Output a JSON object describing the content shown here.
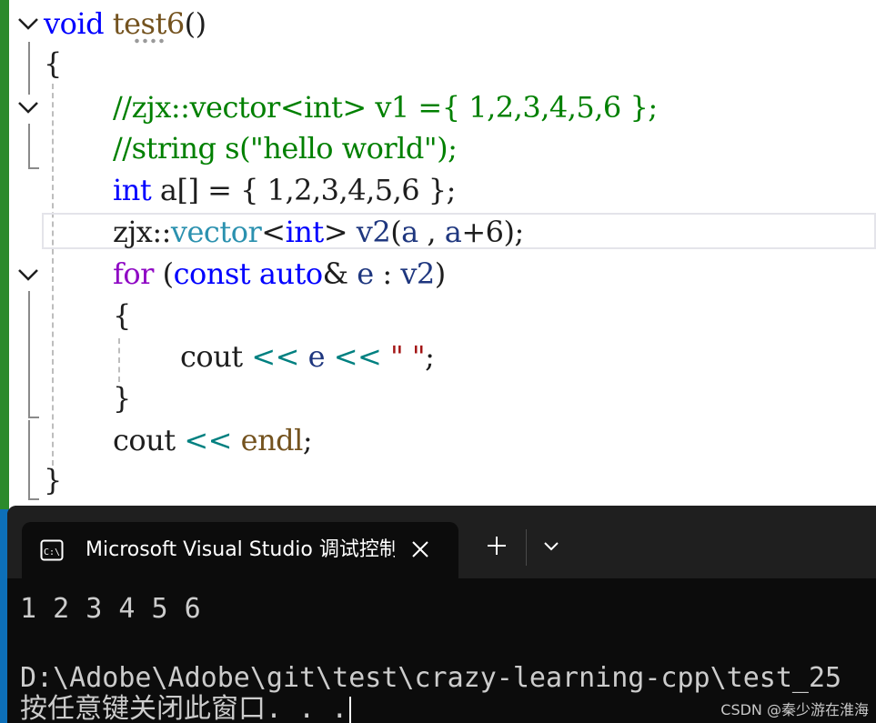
{
  "editor": {
    "lines": {
      "l1": {
        "kw": "void",
        "fn": "test6",
        "rest": "()"
      },
      "l2": {
        "text": "{"
      },
      "l3": {
        "text": "//zjx::vector<int> v1 ={ 1,2,3,4,5,6 };"
      },
      "l4": {
        "text": "//string s(\"hello world\");"
      },
      "l5": {
        "kw": "int",
        "rest": " a[] = { 1,2,3,4,5,6 };"
      },
      "l6": {
        "ns": "zjx::",
        "ty": "vector",
        "lt": "<",
        "kw": "int",
        "gt": ">",
        "sp": " ",
        "id1": "v2",
        "p1": "(",
        "id2": "a",
        "p2": " , ",
        "id3": "a",
        "p3": "+6);"
      },
      "l7": {
        "kw2": "for",
        "p1": " (",
        "kw_const": "const",
        "sp1": " ",
        "kw_auto": "auto",
        "amp": "&",
        "sp2": " ",
        "id1": "e",
        "p2": " : ",
        "id2": "v2",
        "p3": ")"
      },
      "l8": {
        "text": "{"
      },
      "l9": {
        "fn": "cout",
        "sp1": " ",
        "op1": "<<",
        "sp2": " ",
        "id": "e",
        "sp3": " ",
        "op2": "<<",
        "sp4": " ",
        "str": "\" \"",
        "semi": ";"
      },
      "l10": {
        "text": "}"
      },
      "l11": {
        "fn": "cout",
        "sp1": " ",
        "op": "<<",
        "sp2": " ",
        "endl": "endl",
        "semi": ";"
      },
      "l12": {
        "text": "}"
      }
    }
  },
  "terminal": {
    "tab_title": "Microsoft Visual Studio 调试控制台",
    "tab_icon": "console-icon",
    "output_line1": "1 2 3 4 5 6",
    "output_line2": "",
    "output_line3": "D:\\Adobe\\Adobe\\git\\test\\crazy-learning-cpp\\test_25",
    "output_line4": "按任意键关闭此窗口. . ."
  },
  "watermark": "CSDN @秦少游在淮海",
  "colors": {
    "keyword": "#0000ff",
    "control": "#8f08c4",
    "comment": "#008000",
    "function": "#74531f",
    "type": "#2b91af",
    "string": "#a31515",
    "operator": "#008080",
    "identifier": "#1f377f",
    "terminal_bg": "#0c0c0c"
  }
}
